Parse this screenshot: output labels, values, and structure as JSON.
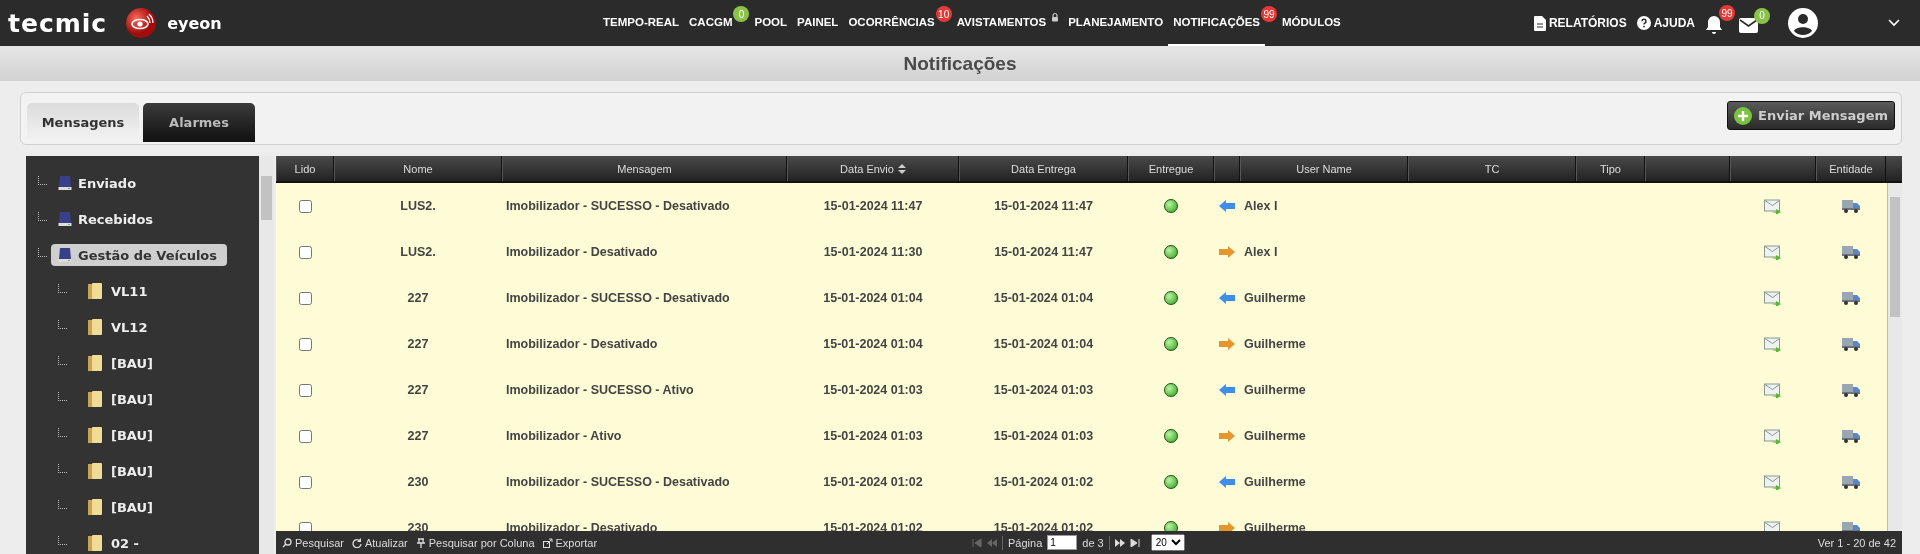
{
  "header": {
    "logos": [
      "tecmic",
      "eyeon"
    ],
    "nav": [
      {
        "label": "TEMPO-REAL",
        "selected": false
      },
      {
        "label": "CACGM",
        "selected": false,
        "badge": "0",
        "color": "#8bc34a"
      },
      {
        "label": "POOL",
        "selected": false
      },
      {
        "label": "PAINEL",
        "selected": false
      },
      {
        "label": "OCORRÊNCIAS",
        "selected": false,
        "badge": "10",
        "color": "#e53935"
      },
      {
        "label": "AVISTAMENTOS",
        "selected": false,
        "locked": true
      },
      {
        "label": "PLANEJAMENTO",
        "selected": false
      },
      {
        "label": "NOTIFICAÇÕES",
        "selected": true,
        "badge": "99",
        "color": "#e53935"
      },
      {
        "label": "MÓDULOS",
        "selected": false
      }
    ],
    "reports": "RELATÓRIOS",
    "help": "AJUDA",
    "notifications_badge": "99",
    "messages_badge": "0"
  },
  "page_title": "Notificações",
  "tabs": [
    {
      "label": "Mensagens",
      "selected": true
    },
    {
      "label": "Alarmes",
      "selected": false
    }
  ],
  "send_button": "Enviar Mensagem",
  "tree": [
    {
      "label": "Enviado",
      "kind": "drive",
      "selected": false
    },
    {
      "label": "Recebidos",
      "kind": "drive",
      "selected": false
    },
    {
      "label": "Gestão de Veículos",
      "kind": "drive",
      "selected": true,
      "children": [
        {
          "label": "VL11",
          "kind": "folder",
          "selected": false
        },
        {
          "label": "VL12",
          "kind": "folder",
          "selected": false
        },
        {
          "label": "[BAU]",
          "kind": "folder",
          "selected": false
        },
        {
          "label": "[BAU]",
          "kind": "folder",
          "selected": false
        },
        {
          "label": "[BAU]",
          "kind": "folder",
          "selected": false
        },
        {
          "label": "[BAU]",
          "kind": "folder",
          "selected": false
        },
        {
          "label": "[BAU]",
          "kind": "folder",
          "selected": false
        },
        {
          "label": "02 -",
          "kind": "folder",
          "selected": false
        }
      ]
    }
  ],
  "table": {
    "columns": [
      {
        "label": "Lido",
        "sorted": false
      },
      {
        "label": "Nome",
        "sorted": false
      },
      {
        "label": "Mensagem",
        "sorted": false
      },
      {
        "label": "Data Envio",
        "sorted": true
      },
      {
        "label": "Data Entrega",
        "sorted": false
      },
      {
        "label": "Entregue",
        "sorted": false
      },
      {
        "sorted": false
      },
      {
        "label": "User Name",
        "sorted": false
      },
      {
        "label": "TC",
        "sorted": false
      },
      {
        "label": "Tipo",
        "sorted": false
      },
      {
        "sorted": false
      },
      {
        "sorted": false
      },
      {
        "label": "Entidade",
        "sorted": false
      }
    ],
    "rows": [
      {
        "read": false,
        "name": "LUS2.",
        "message": "Imobilizador - SUCESSO - Desativado",
        "sent": "15-01-2024 11:47",
        "delivered_at": "15-01-2024 11:47",
        "delivered": true,
        "incoming": true,
        "user": "Alex I"
      },
      {
        "read": false,
        "name": "LUS2.",
        "message": "Imobilizador - Desativado",
        "sent": "15-01-2024 11:30",
        "delivered_at": "15-01-2024 11:47",
        "delivered": true,
        "incoming": false,
        "user": "Alex I"
      },
      {
        "read": false,
        "name": "227",
        "message": "Imobilizador - SUCESSO - Desativado",
        "sent": "15-01-2024 01:04",
        "delivered_at": "15-01-2024 01:04",
        "delivered": true,
        "incoming": true,
        "user": "Guilherme"
      },
      {
        "read": false,
        "name": "227",
        "message": "Imobilizador - Desativado",
        "sent": "15-01-2024 01:04",
        "delivered_at": "15-01-2024 01:04",
        "delivered": true,
        "incoming": false,
        "user": "Guilherme"
      },
      {
        "read": false,
        "name": "227",
        "message": "Imobilizador - SUCESSO - Ativo",
        "sent": "15-01-2024 01:03",
        "delivered_at": "15-01-2024 01:03",
        "delivered": true,
        "incoming": true,
        "user": "Guilherme"
      },
      {
        "read": false,
        "name": "227",
        "message": "Imobilizador - Ativo",
        "sent": "15-01-2024 01:03",
        "delivered_at": "15-01-2024 01:03",
        "delivered": true,
        "incoming": false,
        "user": "Guilherme"
      },
      {
        "read": false,
        "name": "230",
        "message": "Imobilizador - SUCESSO - Desativado",
        "sent": "15-01-2024 01:02",
        "delivered_at": "15-01-2024 01:02",
        "delivered": true,
        "incoming": true,
        "user": "Guilherme"
      },
      {
        "read": false,
        "name": "230",
        "message": "Imobilizador - Desativado",
        "sent": "15-01-2024 01:02",
        "delivered_at": "15-01-2024 01:02",
        "delivered": true,
        "incoming": false,
        "user": "Guilherme"
      }
    ]
  },
  "footer": {
    "actions": [
      {
        "label": "Pesquisar",
        "kind": "search"
      },
      {
        "label": "Atualizar",
        "kind": "refresh"
      },
      {
        "label": "Pesquisar por Coluna",
        "kind": "pin"
      },
      {
        "label": "Exportar",
        "kind": "export"
      }
    ],
    "pager": {
      "buttons": [
        {
          "kind": "first",
          "disabled": true
        },
        {
          "kind": "prev",
          "disabled": true
        },
        {
          "kind": "next",
          "disabled": false
        },
        {
          "kind": "last",
          "disabled": false
        }
      ],
      "page_label": "Página",
      "page": "1",
      "of": "de 3",
      "page_size": "20"
    },
    "summary": "Ver 1 - 20 de 42"
  }
}
